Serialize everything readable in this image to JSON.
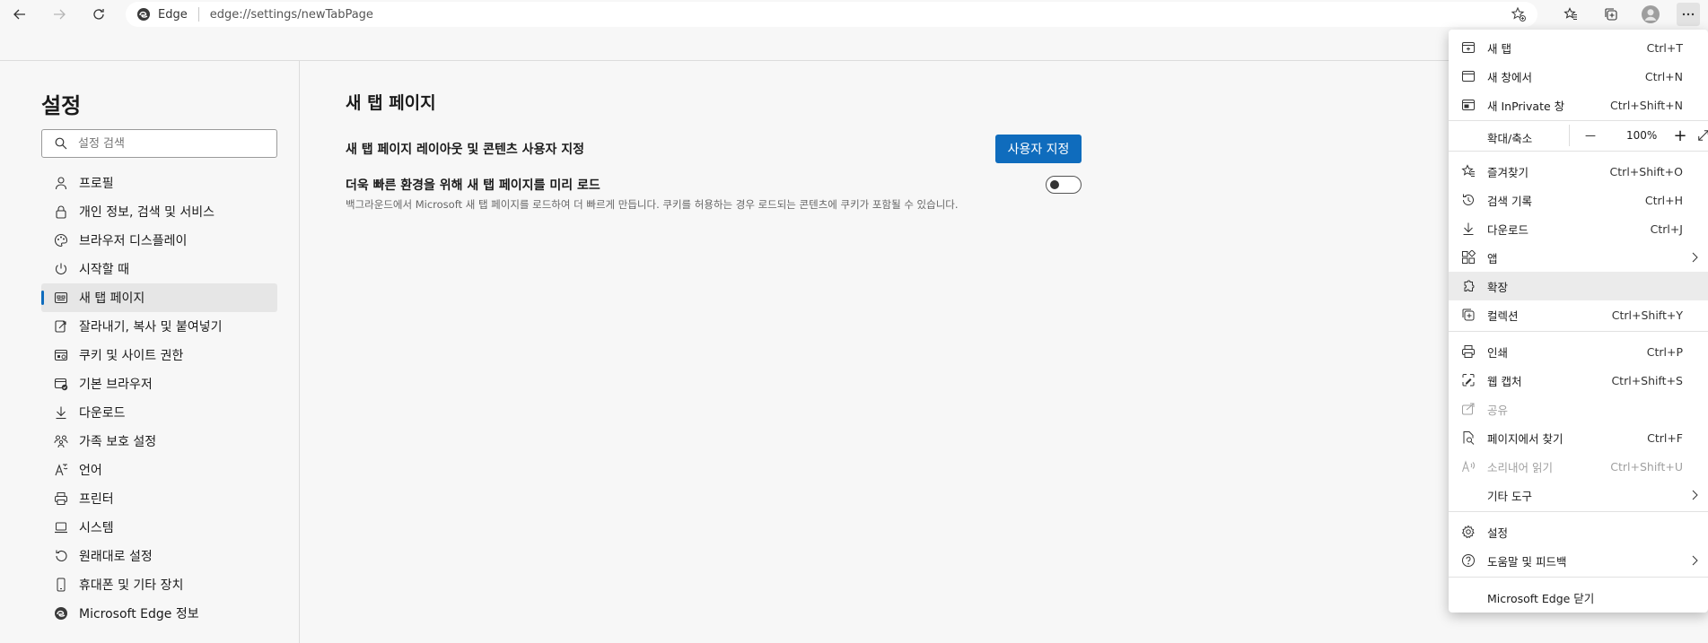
{
  "toolbar": {
    "browser_name": "Edge",
    "url": "edge://settings/newTabPage"
  },
  "sidebar": {
    "title": "설정",
    "search_placeholder": "설정 검색",
    "items": [
      {
        "label": "프로필",
        "icon": "profile-icon"
      },
      {
        "label": "개인 정보, 검색 및 서비스",
        "icon": "lock-icon"
      },
      {
        "label": "브라우저 디스플레이",
        "icon": "palette-icon"
      },
      {
        "label": "시작할 때",
        "icon": "power-icon"
      },
      {
        "label": "새 탭 페이지",
        "icon": "new-tab-page-icon",
        "active": true
      },
      {
        "label": "잘라내기, 복사 및 붙여넣기",
        "icon": "clipboard-icon"
      },
      {
        "label": "쿠키 및 사이트 권한",
        "icon": "cookie-icon"
      },
      {
        "label": "기본 브라우저",
        "icon": "browser-icon"
      },
      {
        "label": "다운로드",
        "icon": "download-icon"
      },
      {
        "label": "가족 보호 설정",
        "icon": "family-icon"
      },
      {
        "label": "언어",
        "icon": "language-icon"
      },
      {
        "label": "프린터",
        "icon": "printer-icon"
      },
      {
        "label": "시스템",
        "icon": "laptop-icon"
      },
      {
        "label": "원래대로 설정",
        "icon": "reset-icon"
      },
      {
        "label": "휴대폰 및 기타 장치",
        "icon": "phone-icon"
      },
      {
        "label": "Microsoft Edge 정보",
        "icon": "edge-logo-icon"
      }
    ]
  },
  "main": {
    "title": "새 탭 페이지",
    "customize_label": "새 탭 페이지 레이아웃 및 콘텐츠 사용자 지정",
    "customize_button": "사용자 지정",
    "preload_label": "더욱 빠른 환경을 위해 새 탭 페이지를 미리 로드",
    "preload_desc": "백그라운드에서 Microsoft 새 탭 페이지를 로드하여 더 빠르게 만듭니다. 쿠키를 허용하는 경우 로드되는 콘텐츠에 쿠키가 포함될 수 있습니다.",
    "preload_enabled": false
  },
  "menu": {
    "new_tab": {
      "label": "새 탭",
      "shortcut": "Ctrl+T"
    },
    "new_window": {
      "label": "새 창에서",
      "shortcut": "Ctrl+N"
    },
    "new_inprivate": {
      "label": "새 InPrivate 창",
      "shortcut": "Ctrl+Shift+N"
    },
    "zoom": {
      "label": "확대/축소",
      "value": "100%",
      "minus": "—",
      "plus": "+"
    },
    "favorites": {
      "label": "즐겨찾기",
      "shortcut": "Ctrl+Shift+O"
    },
    "history": {
      "label": "검색 기록",
      "shortcut": "Ctrl+H"
    },
    "downloads": {
      "label": "다운로드",
      "shortcut": "Ctrl+J"
    },
    "apps": {
      "label": "앱"
    },
    "extensions": {
      "label": "확장"
    },
    "collections": {
      "label": "컬렉션",
      "shortcut": "Ctrl+Shift+Y"
    },
    "print": {
      "label": "인쇄",
      "shortcut": "Ctrl+P"
    },
    "web_capture": {
      "label": "웹 캡처",
      "shortcut": "Ctrl+Shift+S"
    },
    "share": {
      "label": "공유"
    },
    "find": {
      "label": "페이지에서 찾기",
      "shortcut": "Ctrl+F"
    },
    "read_aloud": {
      "label": "소리내어 읽기",
      "shortcut": "Ctrl+Shift+U"
    },
    "more_tools": {
      "label": "기타 도구"
    },
    "settings": {
      "label": "설정"
    },
    "help": {
      "label": "도움말 및 피드백"
    },
    "close": {
      "label": "Microsoft Edge 닫기"
    }
  },
  "colors": {
    "accent": "#0f6cbd"
  }
}
